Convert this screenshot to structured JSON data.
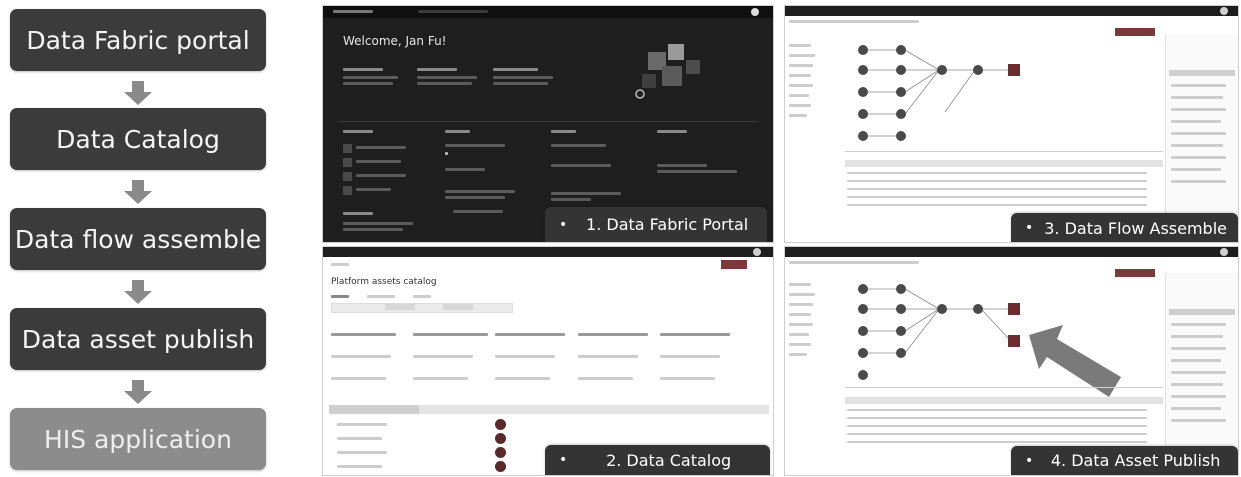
{
  "flow": {
    "steps": [
      {
        "label": "Data Fabric portal"
      },
      {
        "label": "Data Catalog"
      },
      {
        "label": "Data flow assemble"
      },
      {
        "label": "Data asset publish"
      },
      {
        "label": "HIS application"
      }
    ]
  },
  "panels": {
    "portal": {
      "welcome": "Welcome, Jan Fu!",
      "caption": "1. Data Fabric Portal",
      "caption_bullet": "•"
    },
    "catalog": {
      "title": "Platform assets catalog",
      "caption": "2. Data Catalog",
      "caption_bullet": "•"
    },
    "flow_assemble": {
      "caption": "3. Data Flow Assemble",
      "caption_bullet": "•"
    },
    "asset_publish": {
      "caption": "4. Data Asset Publish",
      "caption_bullet": "•"
    }
  },
  "colors": {
    "box_dark": "#3b3b3b",
    "box_light": "#8c8c8c",
    "arrow": "#8a8a8a",
    "caption_bg": "#343434"
  }
}
